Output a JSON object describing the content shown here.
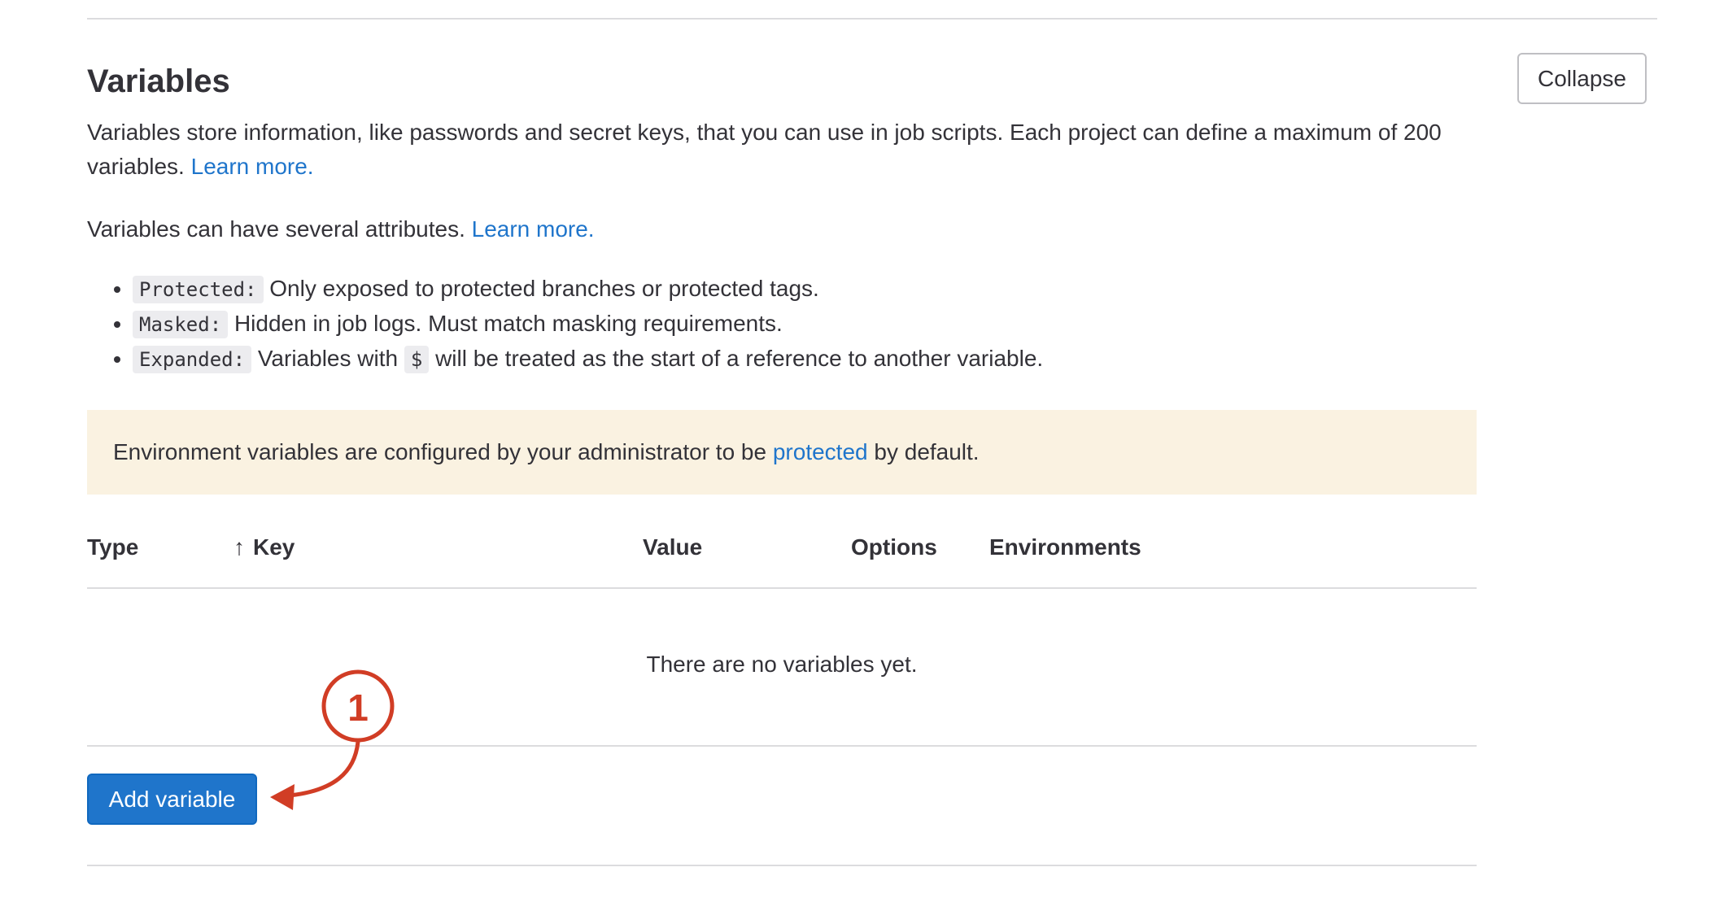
{
  "section": {
    "title": "Variables",
    "collapse_label": "Collapse",
    "description_text": "Variables store information, like passwords and secret keys, that you can use in job scripts. Each project can define a maximum of 200 variables.",
    "description_link": "Learn more.",
    "attributes_intro": "Variables can have several attributes.",
    "attributes_link": "Learn more."
  },
  "attributes": [
    {
      "name": "Protected:",
      "description": "Only exposed to protected branches or protected tags."
    },
    {
      "name": "Masked:",
      "description": "Hidden in job logs. Must match masking requirements."
    },
    {
      "name": "Expanded:",
      "description_before": "Variables with",
      "code": "$",
      "description_after": "will be treated as the start of a reference to another variable."
    }
  ],
  "alert": {
    "text_before": "Environment variables are configured by your administrator to be",
    "link": "protected",
    "text_after": "by default."
  },
  "table": {
    "columns": [
      "Type",
      "Key",
      "Value",
      "Options",
      "Environments"
    ],
    "sort_indicator": "↑",
    "empty_message": "There are no variables yet."
  },
  "add_button_label": "Add variable",
  "annotation": {
    "label": "1",
    "color": "#d13d25"
  },
  "colors": {
    "link": "#1f75cb",
    "primary_button": "#1f75cb",
    "alert_background": "#faf2e1"
  }
}
